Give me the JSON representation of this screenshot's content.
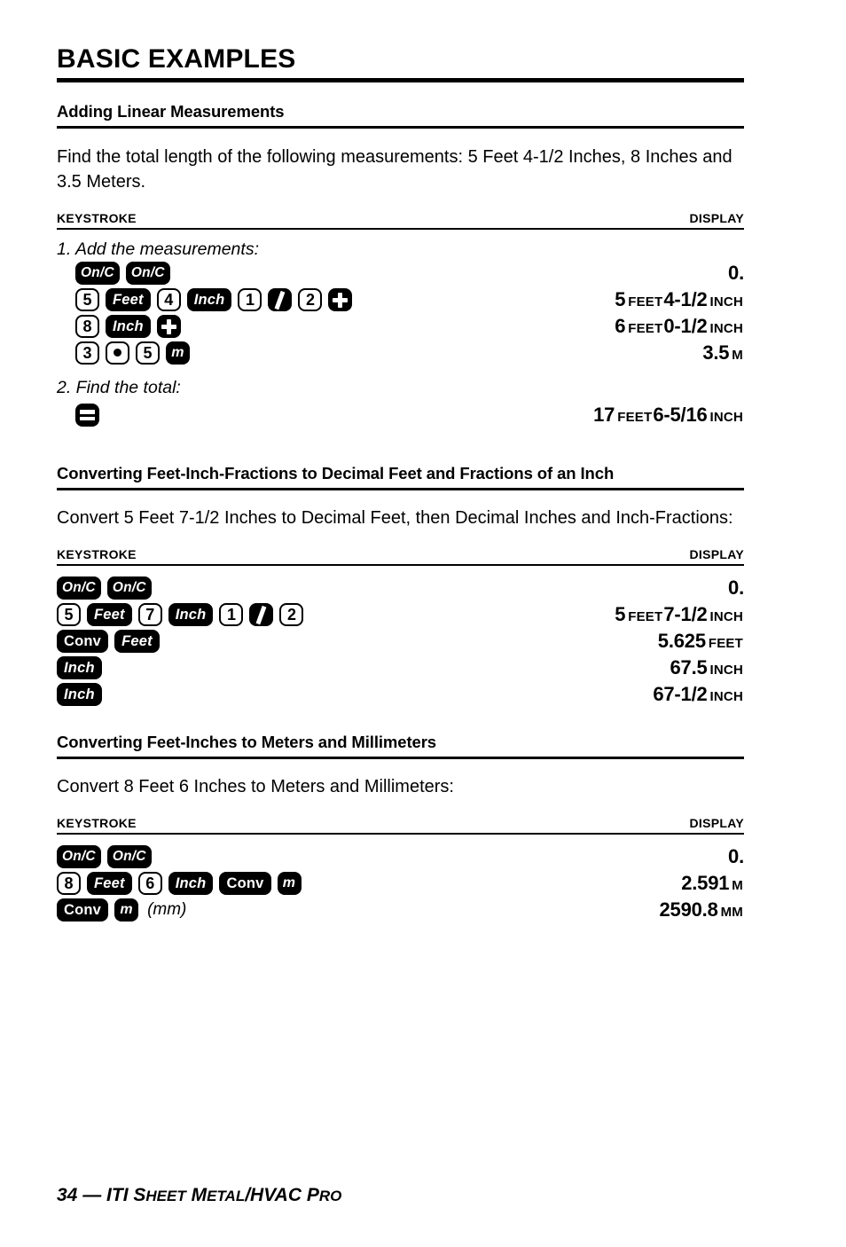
{
  "page_title": "BASIC EXAMPLES",
  "column_headers": {
    "keystroke": "KEYSTROKE",
    "display": "DISPLAY"
  },
  "sections": [
    {
      "heading": "Adding Linear Measurements",
      "intro": "Find the total length of the following measurements: 5 Feet 4-1/2 Inches, 8 Inches and 3.5 Meters.",
      "steps": [
        {
          "label": "1. Add the measurements:"
        },
        {
          "label": "2. Find the total:"
        }
      ]
    },
    {
      "heading": "Converting Feet-Inch-Fractions to Decimal Feet and Fractions of an Inch",
      "intro": "Convert 5 Feet 7-1/2 Inches to Decimal Feet, then Decimal Inches and Inch-Fractions:"
    },
    {
      "heading": "Converting Feet-Inches to Meters and Millimeters",
      "intro": "Convert 8 Feet 6 Inches to Meters and Millimeters:"
    }
  ],
  "rows": {
    "s1r1": {
      "keys": [
        "On/C",
        "On/C"
      ],
      "display_value": "0.",
      "display_unit": ""
    },
    "s1r2": {
      "keys": [
        "5",
        "Feet",
        "4",
        "Inch",
        "1",
        "/",
        "2",
        "+"
      ],
      "display": [
        {
          "value": "5",
          "unit": "FEET"
        },
        {
          "value": "4-1/2",
          "unit": "INCH"
        }
      ]
    },
    "s1r3": {
      "keys": [
        "8",
        "Inch",
        "+"
      ],
      "display": [
        {
          "value": "6",
          "unit": "FEET"
        },
        {
          "value": "0-1/2",
          "unit": "INCH"
        }
      ]
    },
    "s1r4": {
      "keys": [
        "3",
        ".",
        "5",
        "m"
      ],
      "display": [
        {
          "value": "3.5",
          "unit": "M"
        }
      ]
    },
    "s1r5": {
      "keys": [
        "="
      ],
      "display": [
        {
          "value": "17",
          "unit": "FEET"
        },
        {
          "value": "6-5/16",
          "unit": "INCH"
        }
      ]
    },
    "s2r1": {
      "keys": [
        "On/C",
        "On/C"
      ],
      "display": [
        {
          "value": "0.",
          "unit": ""
        }
      ]
    },
    "s2r2": {
      "keys": [
        "5",
        "Feet",
        "7",
        "Inch",
        "1",
        "/",
        "2"
      ],
      "display": [
        {
          "value": "5",
          "unit": "FEET"
        },
        {
          "value": "7-1/2",
          "unit": "INCH"
        }
      ]
    },
    "s2r3": {
      "keys": [
        "Conv",
        "Feet"
      ],
      "display": [
        {
          "value": "5.625",
          "unit": "FEET"
        }
      ]
    },
    "s2r4": {
      "keys": [
        "Inch"
      ],
      "display": [
        {
          "value": "67.5",
          "unit": "INCH"
        }
      ]
    },
    "s2r5": {
      "keys": [
        "Inch"
      ],
      "display": [
        {
          "value": "67-1/2",
          "unit": "INCH"
        }
      ]
    },
    "s3r1": {
      "keys": [
        "On/C",
        "On/C"
      ],
      "display": [
        {
          "value": "0.",
          "unit": ""
        }
      ]
    },
    "s3r2": {
      "keys": [
        "8",
        "Feet",
        "6",
        "Inch",
        "Conv",
        "m"
      ],
      "display": [
        {
          "value": "2.591",
          "unit": "M"
        }
      ]
    },
    "s3r3": {
      "keys": [
        "Conv",
        "m"
      ],
      "annotation": "(mm)",
      "display": [
        {
          "value": "2590.8",
          "unit": "MM"
        }
      ]
    }
  },
  "labels": {
    "onc": "On/C",
    "feet": "Feet",
    "inch": "Inch",
    "conv": "Conv",
    "m": "m",
    "n1": "1",
    "n2": "2",
    "n3": "3",
    "n4": "4",
    "n5": "5",
    "n6": "6",
    "n7": "7",
    "n8": "8",
    "mm_note": "(mm)"
  },
  "footer": {
    "page_number": "34",
    "dash": "—",
    "iti": "ITI",
    "s": "S",
    "heet": "HEET",
    "m": "M",
    "etal": "ETAL",
    "slash_hvac": "/HVAC",
    "p": "P",
    "ro": "RO"
  },
  "colors": {
    "ink": "#000000",
    "paper": "#ffffff"
  }
}
